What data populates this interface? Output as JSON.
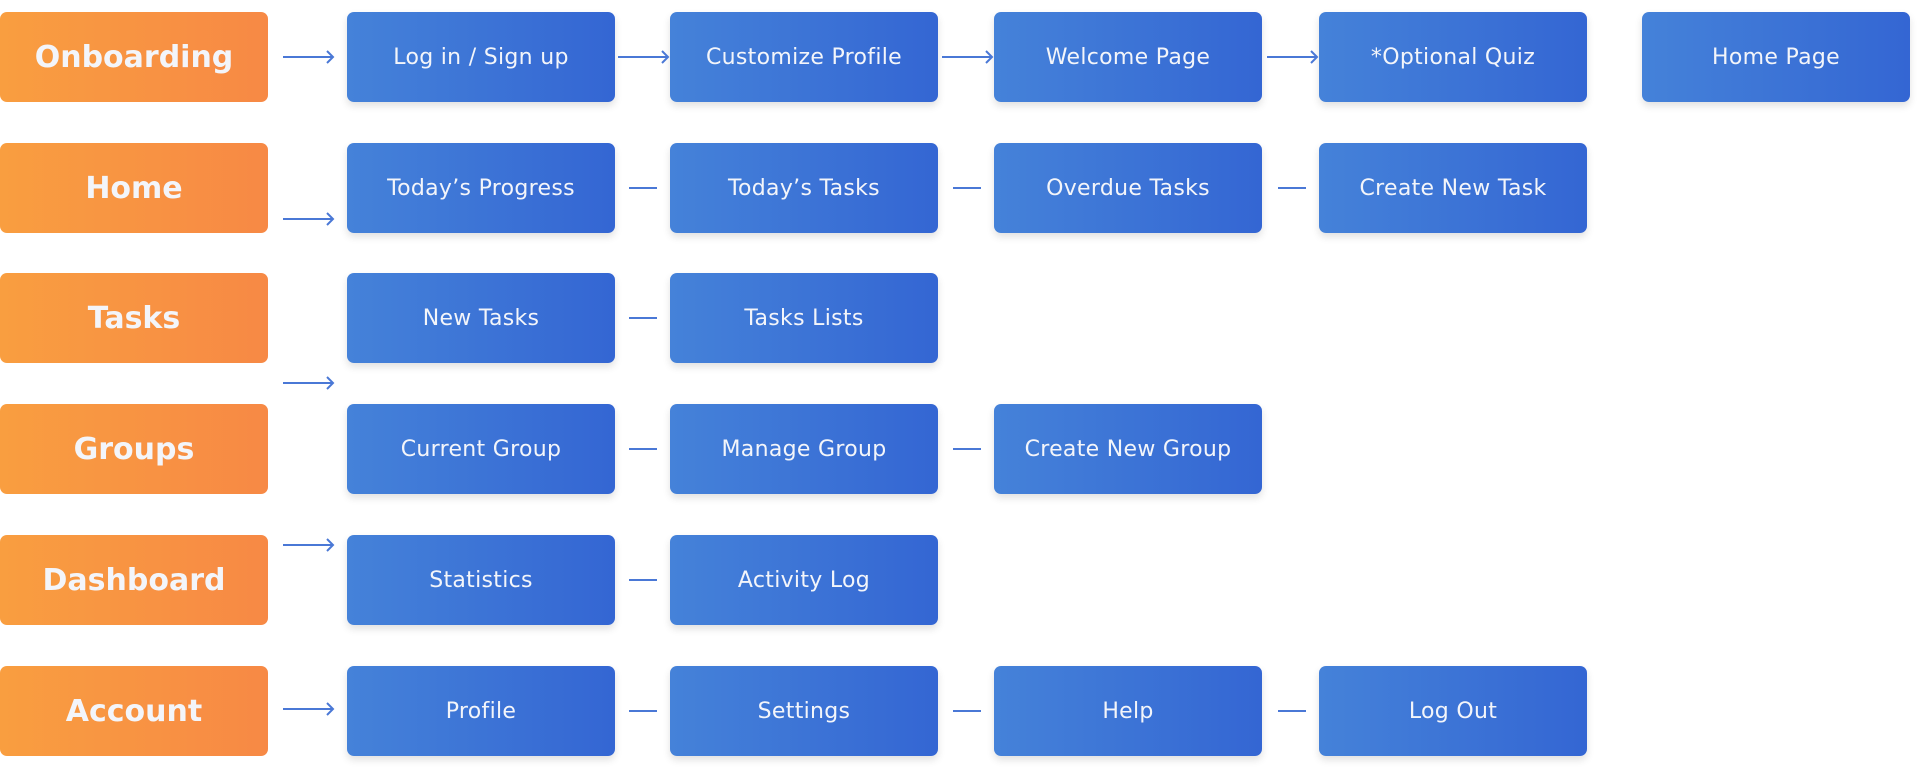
{
  "colors": {
    "section": "#f7904a",
    "node": "#3c72d6",
    "connector": "#4a78d6"
  },
  "rows": [
    {
      "section": "Onboarding",
      "nodes": [
        "Log in / Sign up",
        "Customize Profile",
        "Welcome Page",
        "*Optional Quiz",
        "Home Page"
      ],
      "connector": "arrow"
    },
    {
      "section": "Home",
      "nodes": [
        "Today’s Progress",
        "Today’s Tasks",
        "Overdue Tasks",
        "Create New Task"
      ],
      "connector": "dash"
    },
    {
      "section": "Tasks",
      "nodes": [
        "New Tasks",
        "Tasks Lists"
      ],
      "connector": "dash"
    },
    {
      "section": "Groups",
      "nodes": [
        "Current Group",
        "Manage Group",
        "Create New Group"
      ],
      "connector": "dash"
    },
    {
      "section": "Dashboard",
      "nodes": [
        "Statistics",
        "Activity Log"
      ],
      "connector": "dash"
    },
    {
      "section": "Account",
      "nodes": [
        "Profile",
        "Settings",
        "Help",
        "Log Out"
      ],
      "connector": "dash"
    }
  ]
}
